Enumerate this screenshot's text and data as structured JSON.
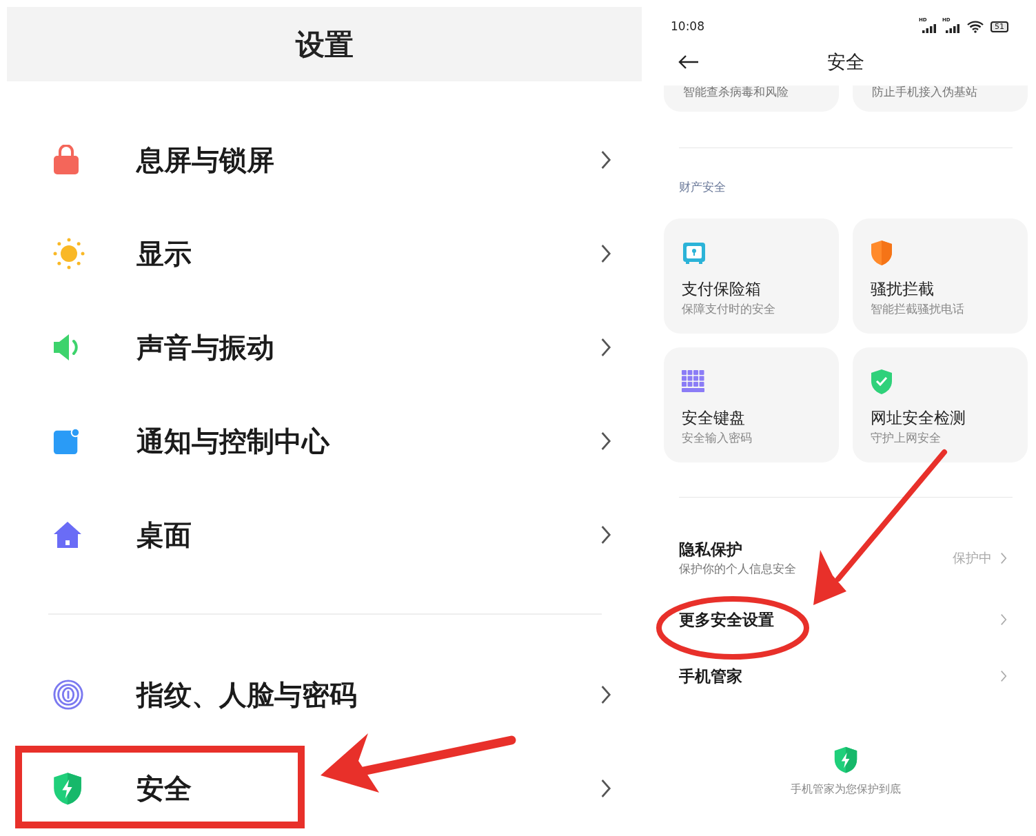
{
  "settings": {
    "title": "设置",
    "groups": [
      [
        {
          "label": "息屏与锁屏"
        },
        {
          "label": "显示"
        },
        {
          "label": "声音与振动"
        },
        {
          "label": "通知与控制中心"
        },
        {
          "label": "桌面"
        }
      ],
      [
        {
          "label": "指纹、人脸与密码"
        },
        {
          "label": "安全"
        }
      ]
    ]
  },
  "security": {
    "status_bar": {
      "time": "10:08",
      "signal_labels": [
        "HD",
        "HD"
      ],
      "battery": "51"
    },
    "title": "安全",
    "top_cards": [
      {
        "subtitle": "智能查杀病毒和风险"
      },
      {
        "subtitle": "防止手机接入伪基站"
      }
    ],
    "section": "财产安全",
    "cards": [
      {
        "title": "支付保险箱",
        "subtitle": "保障支付时的安全"
      },
      {
        "title": "骚扰拦截",
        "subtitle": "智能拦截骚扰电话"
      },
      {
        "title": "安全键盘",
        "subtitle": "安全输入密码"
      },
      {
        "title": "网址安全检测",
        "subtitle": "守护上网安全"
      }
    ],
    "rows": [
      {
        "title": "隐私保护",
        "subtitle": "保护你的个人信息安全",
        "value": "保护中"
      },
      {
        "title": "更多安全设置"
      },
      {
        "title": "手机管家"
      }
    ],
    "footer": "手机管家为您保护到底"
  }
}
